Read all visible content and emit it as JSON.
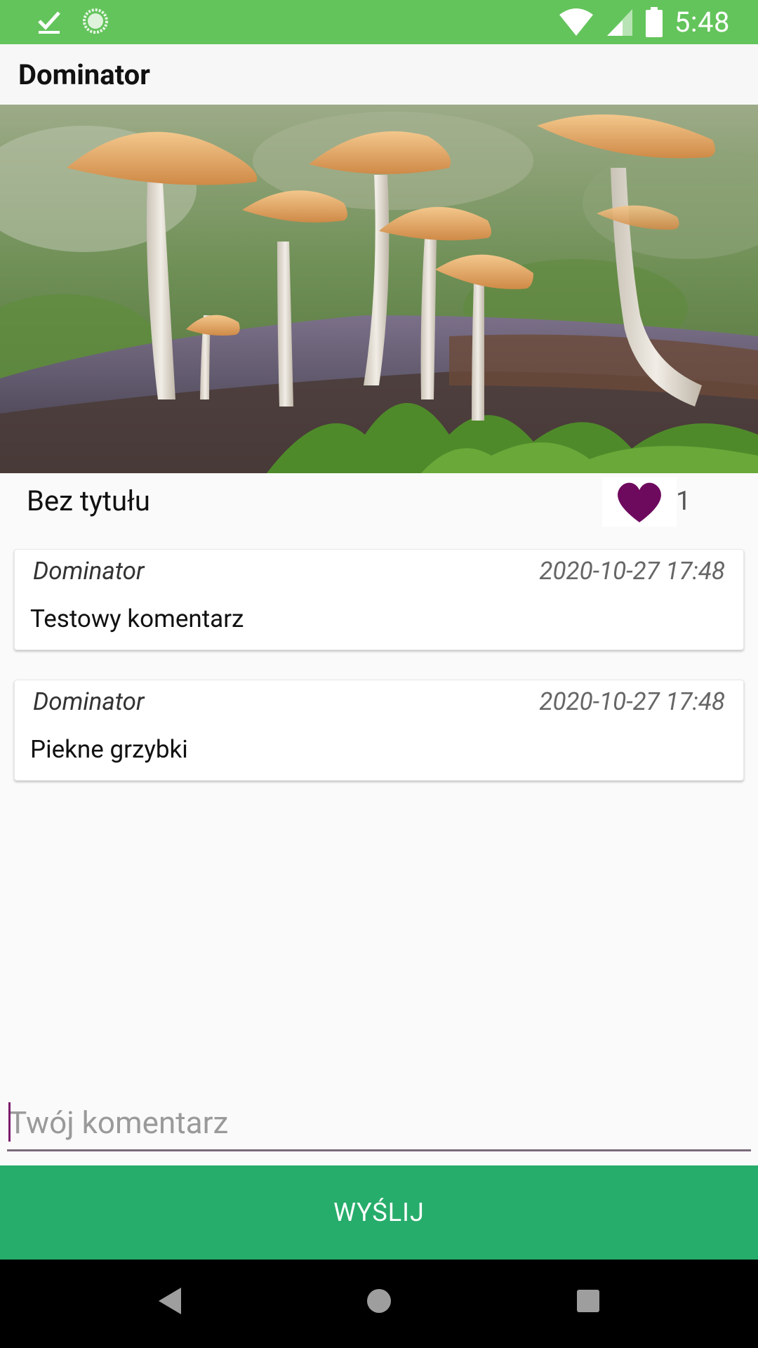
{
  "status_bar": {
    "time": "5:48",
    "icons": [
      "download-done-icon",
      "sync-icon",
      "wifi-icon",
      "cell-signal-icon",
      "battery-icon"
    ]
  },
  "app_bar": {
    "title": "Dominator"
  },
  "post": {
    "image": "mushrooms-photo",
    "title": "Bez tytułu",
    "likes": "1",
    "like_color": "#6e0a5e"
  },
  "comments": [
    {
      "author": "Dominator",
      "date": "2020-10-27 17:48",
      "text": "Testowy komentarz"
    },
    {
      "author": "Dominator",
      "date": "2020-10-27 17:48",
      "text": "Piekne grzybki"
    }
  ],
  "composer": {
    "placeholder": "Twój komentarz",
    "value": "",
    "send_label": "WYŚLIJ",
    "send_color": "#27ad6b"
  },
  "nav_bar": {
    "buttons": [
      "back-icon",
      "home-icon",
      "recents-icon"
    ]
  }
}
